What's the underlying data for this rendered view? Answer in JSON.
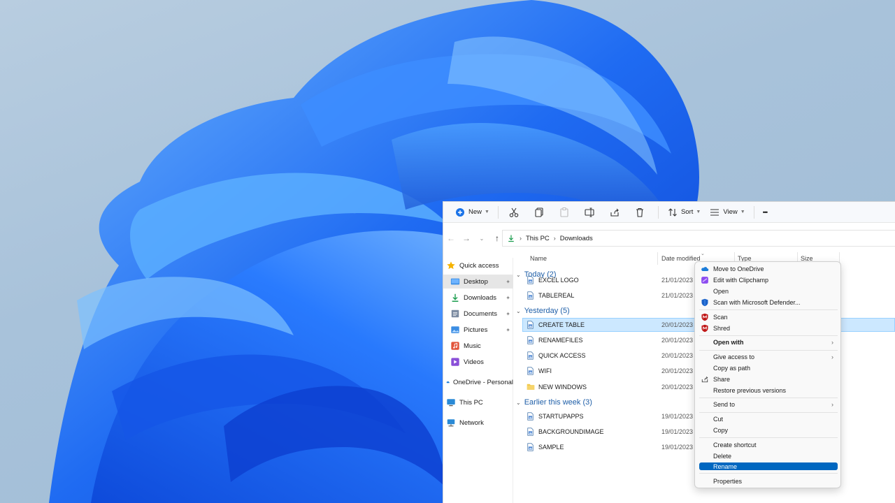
{
  "toolbar": {
    "new_label": "New",
    "sort_label": "Sort",
    "view_label": "View",
    "more_label": "•••"
  },
  "addressbar": {
    "crumbs": [
      "This PC",
      "Downloads"
    ]
  },
  "sidebar": {
    "items": [
      {
        "label": "Quick access",
        "icon": "star-icon"
      },
      {
        "label": "Desktop",
        "icon": "desktop-folder-icon",
        "selected": true,
        "pinned": true
      },
      {
        "label": "Downloads",
        "icon": "download-icon",
        "pinned": true
      },
      {
        "label": "Documents",
        "icon": "documents-icon",
        "pinned": true
      },
      {
        "label": "Pictures",
        "icon": "pictures-icon",
        "pinned": true
      },
      {
        "label": "Music",
        "icon": "music-icon"
      },
      {
        "label": "Videos",
        "icon": "videos-icon"
      },
      {
        "label": "OneDrive - Personal",
        "icon": "onedrive-icon"
      },
      {
        "label": "This PC",
        "icon": "computer-icon"
      },
      {
        "label": "Network",
        "icon": "network-icon"
      }
    ],
    "pin_glyph": "📌"
  },
  "columns": {
    "name": "Name",
    "date": "Date modified",
    "type": "Type",
    "size": "Size"
  },
  "groups": [
    {
      "label": "Today (2)"
    },
    {
      "label": "Yesterday (5)"
    },
    {
      "label": "Earlier this week (3)"
    }
  ],
  "files": [
    {
      "name": "EXCEL LOGO",
      "date": "21/01/2023 0",
      "kind": "doc"
    },
    {
      "name": "TABLEREAL",
      "date": "21/01/2023 0",
      "kind": "doc"
    },
    {
      "name": "CREATE TABLE",
      "date": "20/01/2023 2",
      "kind": "doc",
      "selected": true
    },
    {
      "name": "RENAMEFILES",
      "date": "20/01/2023 2",
      "kind": "doc"
    },
    {
      "name": "QUICK ACCESS",
      "date": "20/01/2023 2",
      "kind": "doc"
    },
    {
      "name": "WIFI",
      "date": "20/01/2023 2",
      "kind": "doc"
    },
    {
      "name": "NEW WINDOWS",
      "date": "20/01/2023 0",
      "kind": "folder"
    },
    {
      "name": "STARTUPAPPS",
      "date": "19/01/2023 2",
      "kind": "doc"
    },
    {
      "name": "BACKGROUNDIMAGE",
      "date": "19/01/2023 2",
      "kind": "doc"
    },
    {
      "name": "SAMPLE",
      "date": "19/01/2023 2",
      "kind": "doc"
    }
  ],
  "context_menu": {
    "items": [
      {
        "label": "Move to OneDrive",
        "icon": "onedrive-icon"
      },
      {
        "label": "Edit with Clipchamp",
        "icon": "clipchamp-icon"
      },
      {
        "label": "Open",
        "icon": ""
      },
      {
        "label": "Scan with Microsoft Defender...",
        "icon": "defender-shield-icon"
      },
      {
        "label": "Scan",
        "icon": "mcafee-icon"
      },
      {
        "label": "Shred",
        "icon": "mcafee-icon"
      },
      {
        "label": "Open with",
        "icon": "",
        "bold": true,
        "submenu": true
      },
      {
        "label": "Give access to",
        "icon": "",
        "submenu": true
      },
      {
        "label": "Copy as path",
        "icon": ""
      },
      {
        "label": "Share",
        "icon": "share-icon"
      },
      {
        "label": "Restore previous versions",
        "icon": ""
      },
      {
        "label": "Send to",
        "icon": "",
        "submenu": true
      },
      {
        "label": "Cut",
        "icon": ""
      },
      {
        "label": "Copy",
        "icon": ""
      },
      {
        "label": "Create shortcut",
        "icon": ""
      },
      {
        "label": "Delete",
        "icon": ""
      },
      {
        "label": "Rename",
        "icon": "",
        "highlighted": true
      },
      {
        "label": "Properties",
        "icon": ""
      }
    ],
    "submenu_arrow": "›"
  },
  "colors": {
    "accent": "#0067c0",
    "selection": "#cce8ff",
    "group_header": "#1f5fa8",
    "wallpaper_blue": "#1a5ff0"
  }
}
